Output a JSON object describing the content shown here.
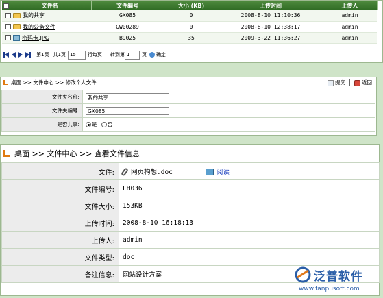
{
  "file_list": {
    "columns": [
      "文件名",
      "文件编号",
      "大小 (KB)",
      "上传时间",
      "上传人"
    ],
    "rows": [
      {
        "icon": "folder-icon",
        "name": "我的共享",
        "code": "GX085",
        "size": "0",
        "time": "2008-8-10 11:10:36",
        "user": "admin"
      },
      {
        "icon": "folder-icon",
        "name": "我的公务文件",
        "code": "GW00289",
        "size": "0",
        "time": "2008-8-10 12:38:17",
        "user": "admin"
      },
      {
        "icon": "image-file-icon",
        "name": "密码卡.JPG",
        "code": "B9025",
        "size": "35",
        "time": "2009-3-22 11:36:27",
        "user": "admin"
      }
    ],
    "pager": {
      "page_label": "第1页",
      "total_label": "共1页",
      "per_page_value": "15",
      "per_page_label": "行每页",
      "goto_label": "转到第",
      "goto_value": "1",
      "page_suffix": "页",
      "confirm_label": "确定"
    }
  },
  "edit_folder": {
    "breadcrumb": "桌面 >> 文件中心 >> 修改个人文件",
    "submit_label": "提交",
    "back_label": "返回",
    "fields": {
      "name_label": "文件夹名称:",
      "name_value": "我的共享",
      "code_label": "文件夹编号:",
      "code_value": "GX085",
      "share_label": "是否共享:",
      "share_yes": "是",
      "share_no": "否"
    }
  },
  "file_info": {
    "breadcrumb": "桌面 >> 文件中心 >> 查看文件信息",
    "file_label": "文件:",
    "file_name": "网页构想.doc",
    "read_label": "阅读",
    "rows": [
      {
        "label": "文件编号:",
        "value": "LH036"
      },
      {
        "label": "文件大小:",
        "value": "153KB"
      },
      {
        "label": "上传时间:",
        "value": "2008-8-10 16:18:13"
      },
      {
        "label": "上传人:",
        "value": "admin"
      },
      {
        "label": "文件类型:",
        "value": "doc"
      },
      {
        "label": "备注信息:",
        "value": "网站设计方案"
      }
    ]
  },
  "watermark": {
    "brand": "泛普软件",
    "url": "www.fanpusoft.com"
  }
}
